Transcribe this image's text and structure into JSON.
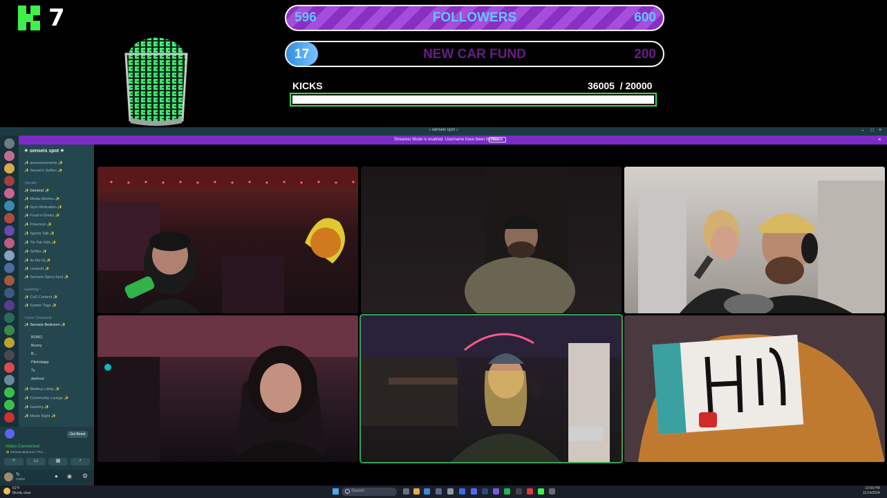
{
  "overlay": {
    "kick_count": "7",
    "followers": {
      "current": "596",
      "label": "FOLLOWERS",
      "goal": "600",
      "progress": 0.993
    },
    "car_fund": {
      "current": "17",
      "label": "NEW CAR FUND",
      "goal": "200",
      "progress": 0.085
    },
    "kicks": {
      "label": "KICKS",
      "value": "36005  / 20000",
      "progress": 1.0
    },
    "colors": {
      "kick_green": "#3df04a",
      "follower_purple": "#8a2fc4",
      "car_blue": "#5ec7ff"
    }
  },
  "discord": {
    "window_title": "♪ senseis spot ♪",
    "notice": {
      "text": "Streamer Mode is enabled. Username have been hidden.",
      "button": "Disable"
    },
    "server_name": "✴ senseis spot ✴",
    "channels_top": [
      "✨ announcements ✨",
      "✨ Sensei's Selfies ✨"
    ],
    "category_1": "~Social~",
    "channels_social": [
      "✨ General ✨",
      "✨ Media-Memes ✨",
      "✨ Gym-Motivation ✨",
      "✨ Food-n-Drinks ✨",
      "✨ Pokemon ✨",
      "✨ Sports-Talk ✨",
      "✨ Tik-Tok-Vids ✨",
      "✨ Selfies ✨",
      "✨ Its-My-Dj ✨",
      "✨ Leopold ✨",
      "✨ Senseis-Spicy-Spot ✨"
    ],
    "category_2": "~Gaming~",
    "channels_gaming": [
      "✨ CoD Content ✨",
      "✨ Gamer-Tags ✨"
    ],
    "category_3": "~Voice Channels~",
    "voice_active": "✨ Senseis Bedroom ✨",
    "voice_users": [
      "BOBO",
      "Boony",
      "B...",
      "Pitchslapp",
      "Ty",
      "darknut"
    ],
    "voice_others": [
      "✨ Waiting Lobby ✨",
      "✨ Community Lounge ✨",
      "✨ Gaming ✨",
      "✨ Movie Night ✨"
    ],
    "vc_status": "Video Connected",
    "vc_channel": "✨ Senseis Bedroom / Priv...",
    "vc_boost": "Get Boost",
    "user_name": "Ty",
    "user_status": "Online"
  },
  "taskbar": {
    "search_placeholder": "Search",
    "weather": "61°F",
    "weather_desc": "Mostly clear",
    "time": "10:56 PM",
    "date": "11/14/2024"
  }
}
